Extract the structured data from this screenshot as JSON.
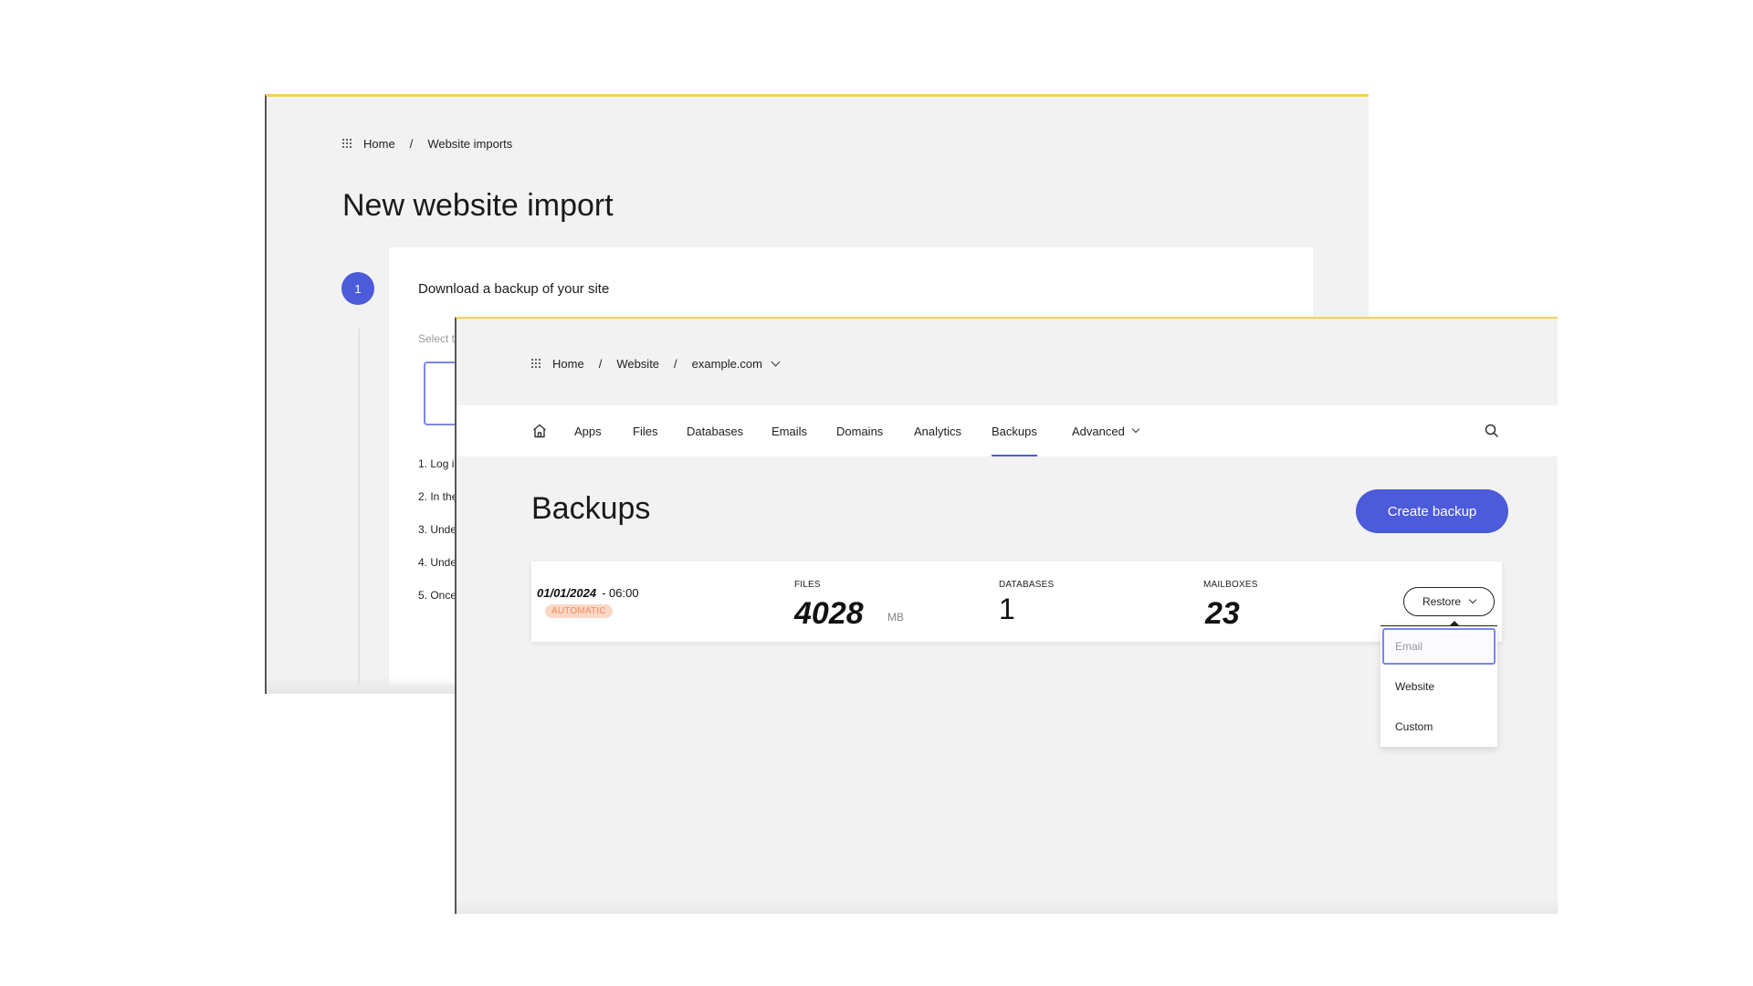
{
  "colors": {
    "accent": "#4c5bd9",
    "window_top_border": "#f7cf5a",
    "badge_bg": "#fbd8c6",
    "badge_text": "#f08a5d"
  },
  "back_window": {
    "breadcrumb": {
      "icon": "apps-grid-icon",
      "items": [
        "Home",
        "Website imports"
      ],
      "separator": "/"
    },
    "title": "New website import",
    "step": {
      "number": "1",
      "title": "Download a backup of your site",
      "select_label": "Select t",
      "instructions": [
        "1. Log i",
        "2. In the",
        "3. Unde",
        "4. Unde",
        "5. Once"
      ]
    }
  },
  "front_window": {
    "breadcrumb": {
      "icon": "apps-grid-icon",
      "items": [
        "Home",
        "Website",
        "example.com"
      ],
      "separator": "/",
      "dropdown_icon": "chevron-down-icon"
    },
    "nav": {
      "home_icon": "home-icon",
      "items": [
        {
          "label": "Apps"
        },
        {
          "label": "Files"
        },
        {
          "label": "Databases"
        },
        {
          "label": "Emails"
        },
        {
          "label": "Domains"
        },
        {
          "label": "Analytics"
        },
        {
          "label": "Backups",
          "active": true
        },
        {
          "label": "Advanced",
          "has_dropdown": true
        }
      ],
      "search_icon": "search-icon"
    },
    "page_title": "Backups",
    "create_button": "Create backup",
    "backup": {
      "date": "01/01/2024",
      "time": "- 06:00",
      "badge": "AUTOMATIC",
      "files_label": "FILES",
      "files_value": "4028",
      "files_unit": "MB",
      "databases_label": "DATABASES",
      "databases_value": "1",
      "mailboxes_label": "MAILBOXES",
      "mailboxes_value": "23",
      "restore_button": "Restore"
    },
    "restore_menu": {
      "items": [
        "Email",
        "Website",
        "Custom"
      ],
      "focused": "Email"
    }
  }
}
